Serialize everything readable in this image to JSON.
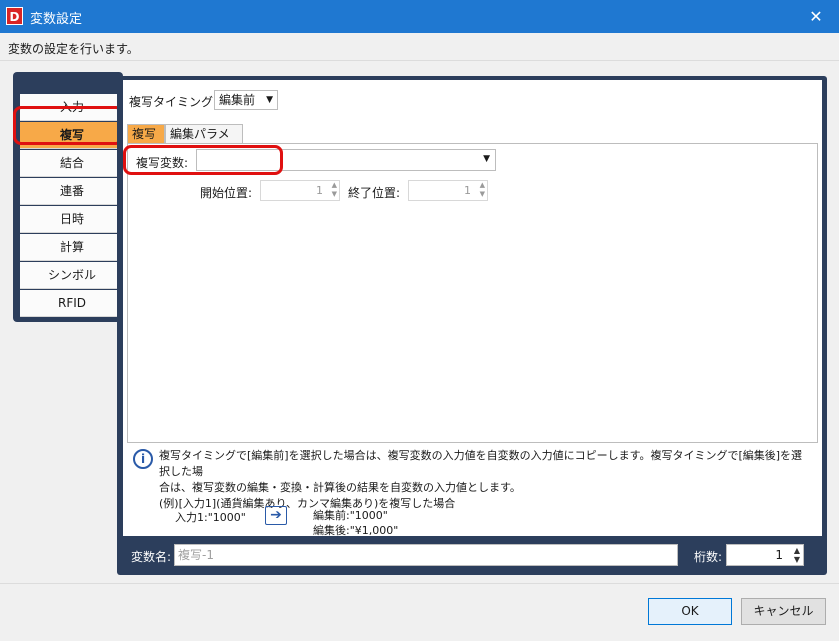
{
  "window": {
    "icon_letter": "D",
    "title": "変数設定",
    "close_glyph": "✕"
  },
  "description": "変数の設定を行います。",
  "nav": {
    "items": [
      {
        "label": "入力"
      },
      {
        "label": "複写"
      },
      {
        "label": "結合"
      },
      {
        "label": "連番"
      },
      {
        "label": "日時"
      },
      {
        "label": "計算"
      },
      {
        "label": "シンボル"
      },
      {
        "label": "RFID"
      }
    ],
    "active": "複写"
  },
  "timing": {
    "label": "複写タイミング:",
    "value": "編集前"
  },
  "tabs": [
    {
      "label": "複写"
    },
    {
      "label": "編集パラメータ"
    }
  ],
  "copy": {
    "var_label": "複写変数:",
    "var_value": "",
    "start_label": "開始位置:",
    "start_value": "1",
    "end_label": "終了位置:",
    "end_value": "1"
  },
  "info": {
    "text_line1": "複写タイミングで[編集前]を選択した場合は、複写変数の入力値を自変数の入力値にコピーします。複写タイミングで[編集後]を選択した場",
    "text_line2": "合は、複写変数の編集・変換・計算後の結果を自変数の入力値とします。",
    "text_line3": "(例)[入力1](通貨編集あり、カンマ編集あり)を複写した場合",
    "example_input": "入力1:\"1000\"",
    "example_before": "編集前:\"1000\"",
    "example_after": "編集後:\"¥1,000\""
  },
  "bottom": {
    "var_name_label": "変数名:",
    "var_name_placeholder": "複写-1",
    "digits_label": "桁数:",
    "digits_value": "1"
  },
  "buttons": {
    "ok": "OK",
    "cancel": "キャンセル"
  },
  "colors": {
    "titlebar": "#1f78d1",
    "panel": "#2c3e5c",
    "active": "#f7a948",
    "highlight": "#e01010"
  }
}
